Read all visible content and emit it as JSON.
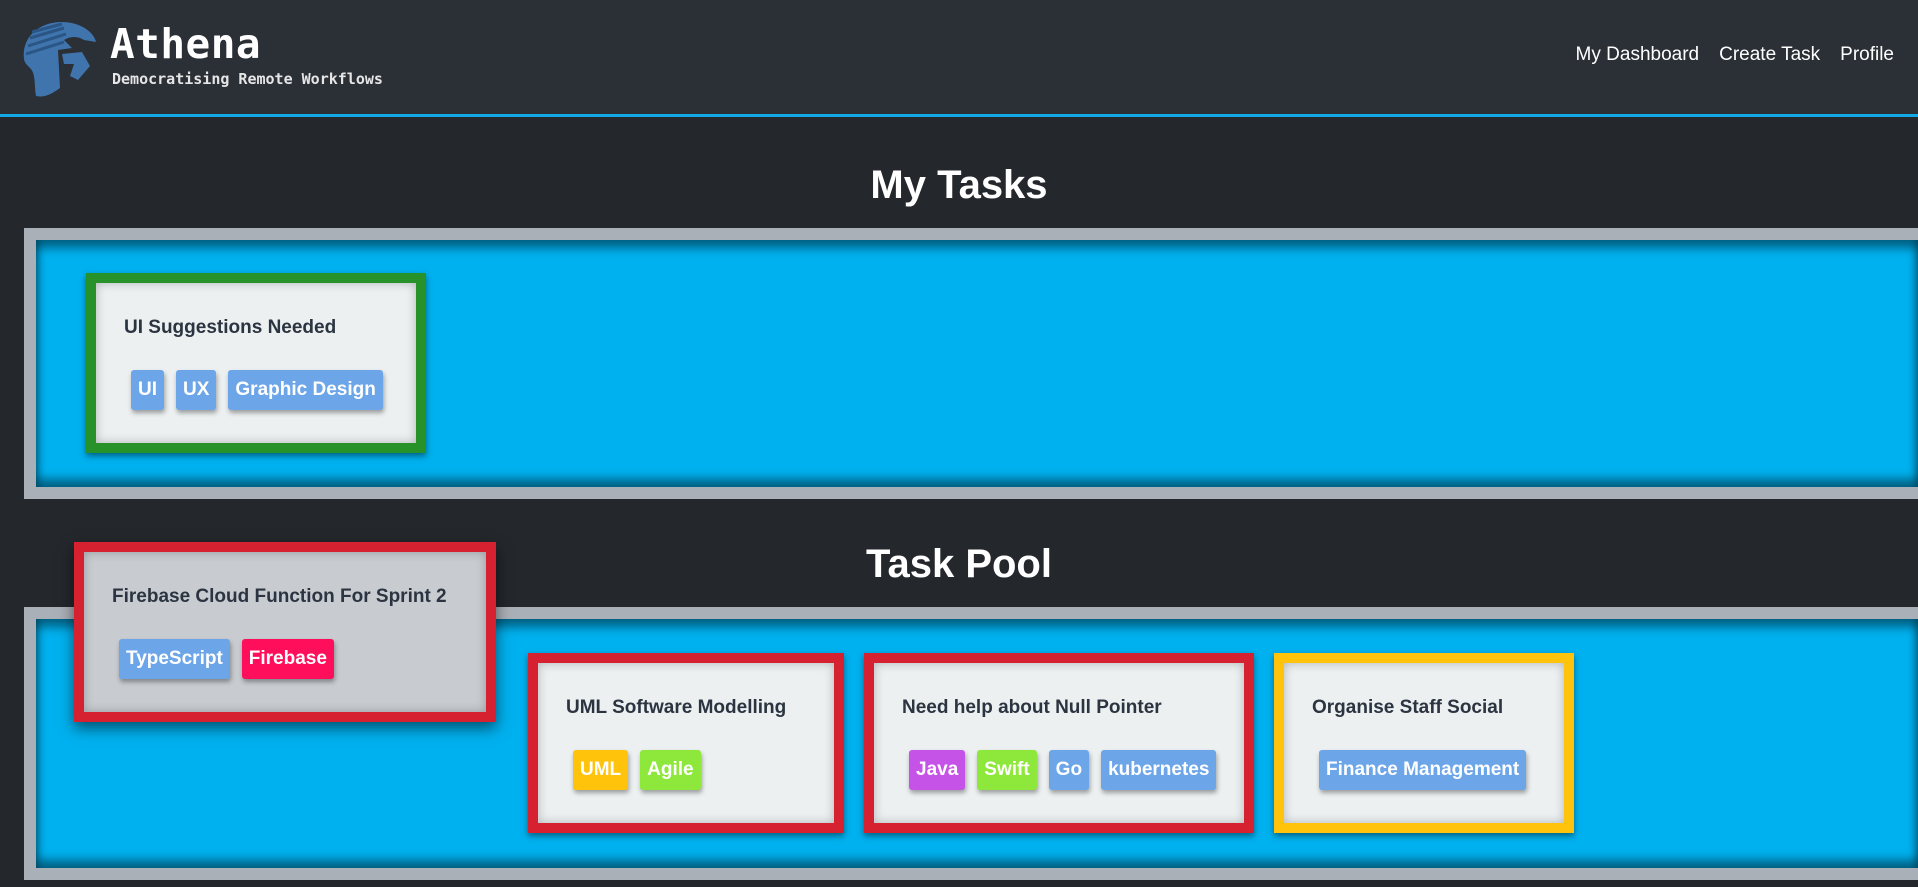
{
  "header": {
    "logo_icon": "spartan-helmet-icon",
    "title": "Athena",
    "subtitle": "Democratising Remote Workflows",
    "nav": [
      {
        "label": "My Dashboard"
      },
      {
        "label": "Create Task"
      },
      {
        "label": "Profile"
      }
    ]
  },
  "colors": {
    "background": "#24272c",
    "navbar": "#2b2f36",
    "accent": "#12a9e6",
    "board": "#00b1ef",
    "board_border": "#aab0b7",
    "card": "#ecf0f1",
    "status_green": "#27922a",
    "status_red": "#d62230",
    "status_yellow": "#ffc30b",
    "tag_blue": "#6ca5e8",
    "tag_pink": "#ff0f5b",
    "tag_orange": "#ffc30b",
    "tag_lime": "#8ee83b",
    "tag_purple": "#c653e8"
  },
  "my_tasks": {
    "title": "My Tasks",
    "cards": [
      {
        "title": "UI Suggestions Needed",
        "status": "green",
        "tags": [
          {
            "label": "UI",
            "color": "#6ca5e8"
          },
          {
            "label": "UX",
            "color": "#6ca5e8"
          },
          {
            "label": "Graphic Design",
            "color": "#6ca5e8"
          }
        ]
      }
    ]
  },
  "task_pool": {
    "title": "Task Pool",
    "cards": [
      {
        "title": "Firebase Cloud Function For Sprint 2",
        "status": "red",
        "tags": [
          {
            "label": "TypeScript",
            "color": "#6ca5e8"
          },
          {
            "label": "Firebase",
            "color": "#ff0f5b"
          }
        ]
      },
      {
        "title": "UML Software Modelling",
        "status": "red",
        "tags": [
          {
            "label": "UML",
            "color": "#ffc30b"
          },
          {
            "label": "Agile",
            "color": "#8ee83b"
          }
        ]
      },
      {
        "title": "Need help about Null Pointer",
        "status": "red",
        "tags": [
          {
            "label": "Java",
            "color": "#c653e8"
          },
          {
            "label": "Swift",
            "color": "#8ee83b"
          },
          {
            "label": "Go",
            "color": "#6ca5e8"
          },
          {
            "label": "kubernetes",
            "color": "#6ca5e8"
          }
        ]
      },
      {
        "title": "Organise Staff Social",
        "status": "yellow",
        "tags": [
          {
            "label": "Finance Management",
            "color": "#6ca5e8"
          }
        ]
      }
    ]
  }
}
